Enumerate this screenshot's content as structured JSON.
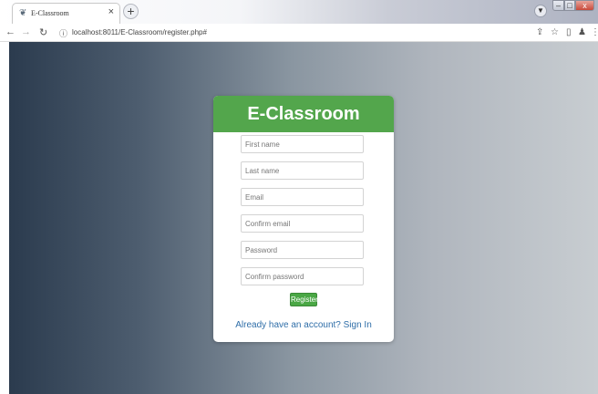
{
  "browser": {
    "tab_title": "E-Classroom",
    "tab_close": "×",
    "new_tab": "+",
    "url": "localhost:8011/E-Classroom/register.php#"
  },
  "form": {
    "title": "E-Classroom",
    "fields": {
      "first_name": "First name",
      "last_name": "Last name",
      "email": "Email",
      "confirm_email": "Confirm email",
      "password": "Password",
      "confirm_password": "Confirm password"
    },
    "register_label": "Register",
    "signin_link": "Already have an account? Sign In"
  },
  "colors": {
    "header_green": "#53a64c",
    "button_green": "#4aa745",
    "link_blue": "#2f6ea8"
  }
}
